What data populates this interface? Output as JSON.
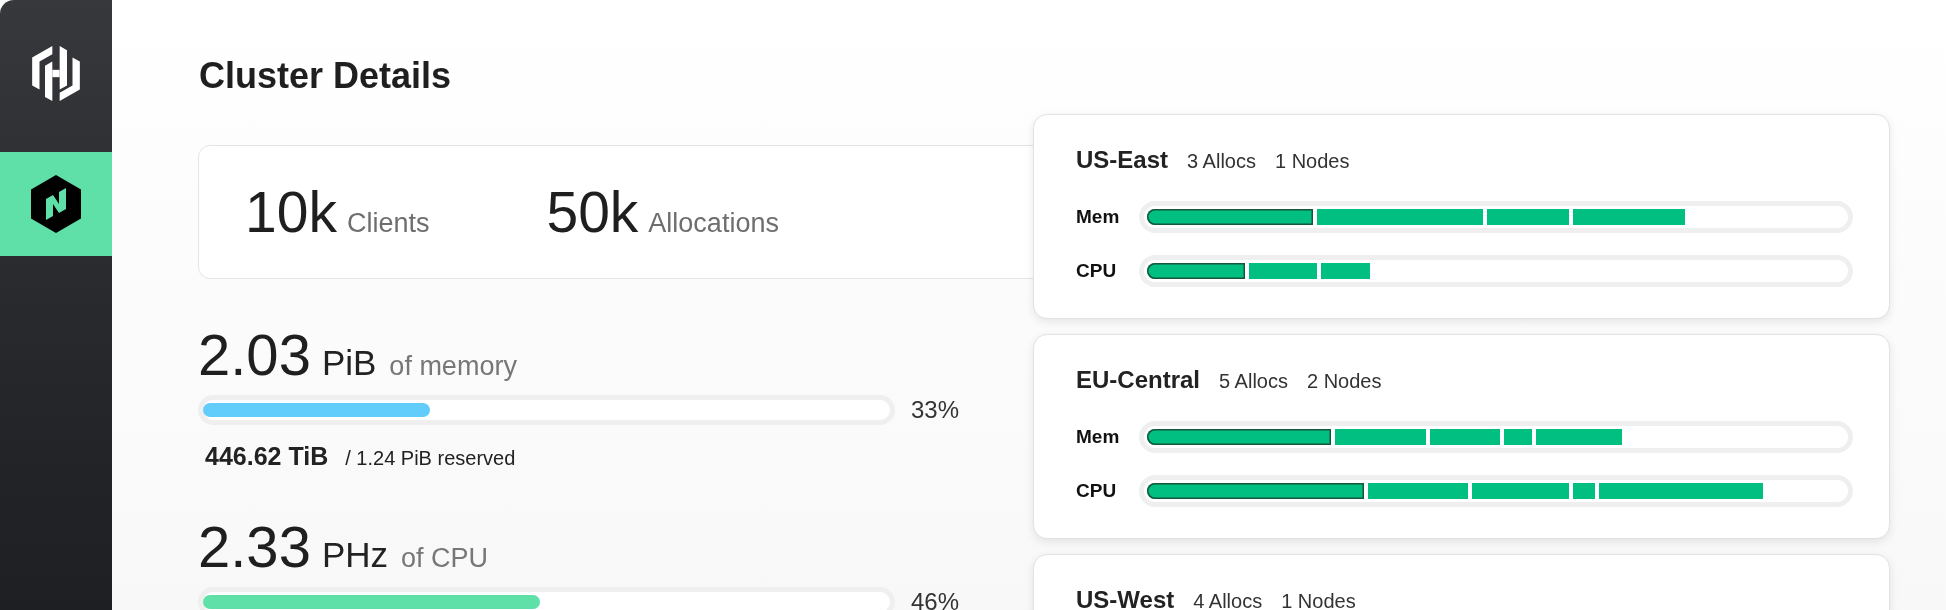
{
  "sidebar": {
    "items": [
      {
        "selected": true
      }
    ]
  },
  "page": {
    "title": "Cluster Details"
  },
  "summary": [
    {
      "value": "10k",
      "label": "Clients"
    },
    {
      "value": "50k",
      "label": "Allocations"
    }
  ],
  "resources": [
    {
      "amount": "2.03",
      "unit": "PiB",
      "label": "of memory",
      "level": 0.33,
      "percent": "33%",
      "color": "#62cdfb",
      "used": "446.62 TiB",
      "reserved": "/ 1.24 PiB reserved"
    },
    {
      "amount": "2.33",
      "unit": "PHz",
      "label": "of CPU",
      "level": 0.49,
      "percent": "46%",
      "color": "#5ee0a8"
    }
  ],
  "regions": [
    {
      "name": "US-East",
      "allocs": "3 Allocs",
      "nodes": "1 Nodes",
      "bars": [
        {
          "label": "Mem"
        },
        {
          "label": "CPU"
        }
      ]
    },
    {
      "name": "EU-Central",
      "allocs": "5 Allocs",
      "nodes": "2 Nodes",
      "bars": [
        {
          "label": "Mem"
        },
        {
          "label": "CPU"
        }
      ]
    },
    {
      "name": "US-West",
      "allocs": "4 Allocs",
      "nodes": "1 Nodes"
    }
  ]
}
